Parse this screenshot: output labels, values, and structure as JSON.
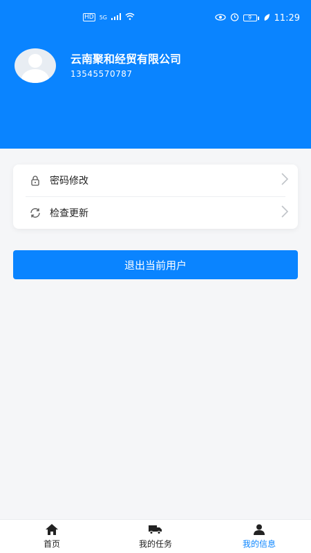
{
  "status_bar": {
    "left_icons": [
      "hd-icon",
      "5g-icon",
      "signal-icon",
      "wifi-icon"
    ],
    "right_icons": [
      "eye-icon",
      "alarm-icon",
      "battery-icon",
      "leaf-icon"
    ],
    "battery_level": "9",
    "time": "11:29"
  },
  "profile": {
    "company": "云南聚和经贸有限公司",
    "phone": "13545570787"
  },
  "menu": {
    "items": [
      {
        "icon": "lock-icon",
        "label": "密码修改"
      },
      {
        "icon": "refresh-icon",
        "label": "检查更新"
      }
    ]
  },
  "logout_label": "退出当前用户",
  "tabbar": {
    "tabs": [
      {
        "icon": "home-icon",
        "label": "首页"
      },
      {
        "icon": "truck-icon",
        "label": "我的任务"
      },
      {
        "icon": "user-icon",
        "label": "我的信息"
      }
    ],
    "active_index": 2
  },
  "colors": {
    "accent": "#0a84ff",
    "background": "#f5f6f8"
  }
}
